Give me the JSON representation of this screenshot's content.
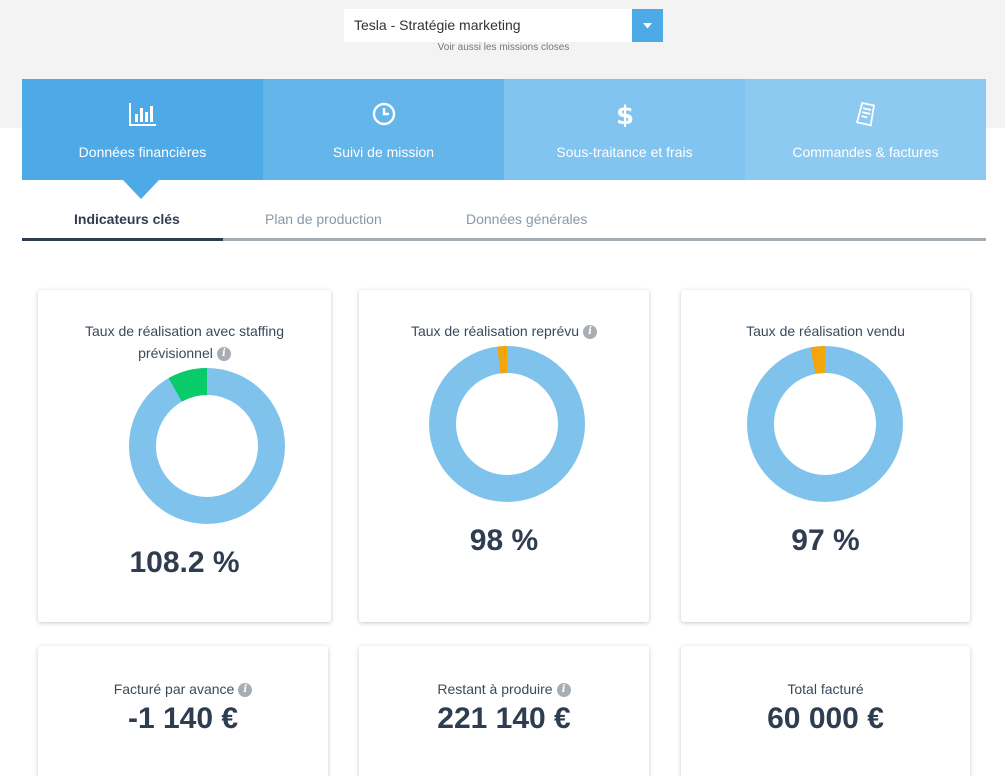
{
  "mission_selector": {
    "value": "Tesla - Stratégie marketing",
    "closed_missions_link": "Voir aussi les missions closes"
  },
  "main_tabs": [
    {
      "label": "Données financières",
      "icon": "bar-chart-icon"
    },
    {
      "label": "Suivi de mission",
      "icon": "clock-icon"
    },
    {
      "label": "Sous-traitance et frais",
      "icon": "dollar-icon"
    },
    {
      "label": "Commandes & factures",
      "icon": "invoice-icon"
    }
  ],
  "sub_tabs": [
    {
      "label": "Indicateurs clés"
    },
    {
      "label": "Plan de production"
    },
    {
      "label": "Données générales"
    }
  ],
  "kpi_cards": [
    {
      "title": "Taux de réalisation avec staffing prévisionnel",
      "value": "108.2 %",
      "fraction": 0.082,
      "segment_color": "#0acb6a",
      "has_info": true
    },
    {
      "title": "Taux de réalisation reprévu",
      "value": "98 %",
      "fraction": 0.02,
      "segment_color": "#f4a50c",
      "has_info": true
    },
    {
      "title": "Taux de réalisation vendu",
      "value": "97 %",
      "fraction": 0.03,
      "segment_color": "#f4a50c",
      "has_info": false
    }
  ],
  "money_cards": [
    {
      "title": "Facturé par avance",
      "value": "-1 140 €",
      "has_info": true
    },
    {
      "title": "Restant à produire",
      "value": "221 140 €",
      "has_info": true
    },
    {
      "title": "Total facturé",
      "value": "60 000 €",
      "has_info": false
    }
  ],
  "colors": {
    "accent": "#4eaae6",
    "ring": "#7fc3ec",
    "text_dark": "#2e3d4f"
  }
}
